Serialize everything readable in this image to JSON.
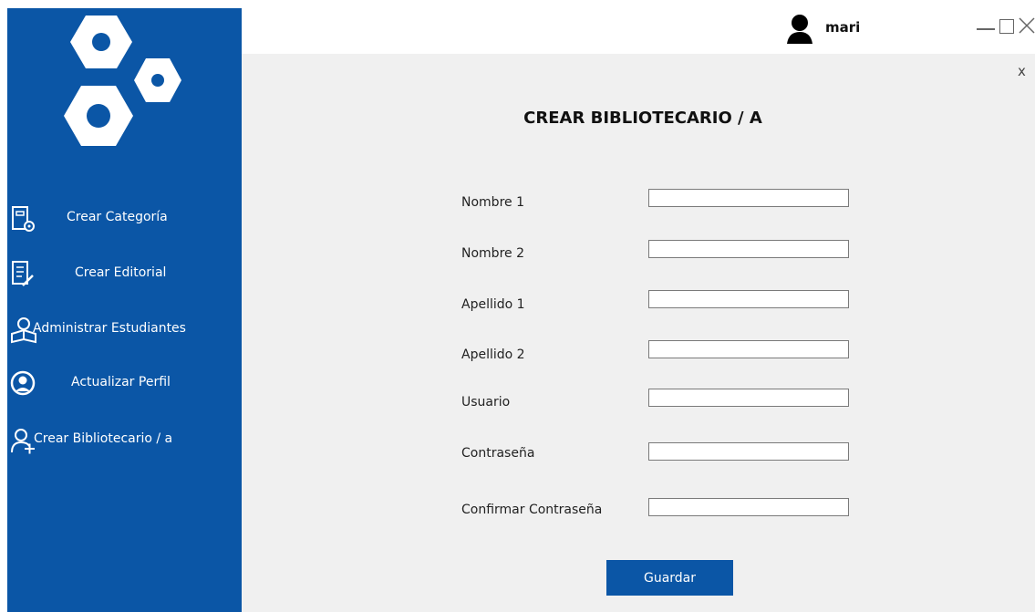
{
  "topbar": {
    "user_name": "mari"
  },
  "sidebar": {
    "items": [
      {
        "label": "Crear Categoría",
        "icon": "category-settings-icon"
      },
      {
        "label": "Crear Editorial",
        "icon": "editorial-document-icon"
      },
      {
        "label": "Administrar Estudiantes",
        "icon": "student-reading-icon"
      },
      {
        "label": "Actualizar Perfil",
        "icon": "profile-update-icon"
      },
      {
        "label": "Crear Bibliotecario / a",
        "icon": "add-user-icon"
      }
    ]
  },
  "form": {
    "close_label": "x",
    "title": "CREAR BIBLIOTECARIO / A",
    "fields": [
      {
        "label": "Nombre 1",
        "value": ""
      },
      {
        "label": "Nombre 2",
        "value": ""
      },
      {
        "label": "Apellido 1",
        "value": ""
      },
      {
        "label": "Apellido 2",
        "value": ""
      },
      {
        "label": "Usuario",
        "value": ""
      },
      {
        "label": "Contraseña",
        "value": ""
      },
      {
        "label": "Confirmar Contraseña",
        "value": ""
      }
    ],
    "save_label": "Guardar"
  },
  "colors": {
    "sidebar": "#0b56a6",
    "content_bg": "#f0f0f0",
    "button": "#0b56a6"
  }
}
